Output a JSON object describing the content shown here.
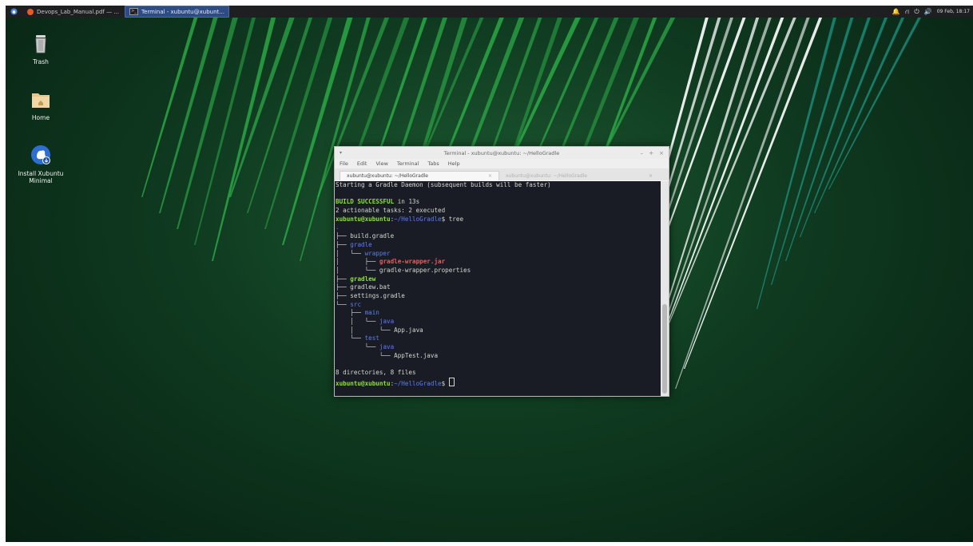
{
  "panel": {
    "tasks": [
      {
        "label": "Devops_Lab_Manual.pdf — ...",
        "active": false
      },
      {
        "label": "Terminal - xubuntu@xubunt...",
        "active": true
      }
    ],
    "clock": "09 Feb, 18:17"
  },
  "desktop": {
    "icons": [
      {
        "label": "Trash"
      },
      {
        "label": "Home"
      },
      {
        "label": "Install Xubuntu\nMinimal"
      }
    ]
  },
  "terminal": {
    "title": "Terminal - xubuntu@xubuntu: ~/HelloGradle",
    "menu": [
      "File",
      "Edit",
      "View",
      "Terminal",
      "Tabs",
      "Help"
    ],
    "tabs": [
      {
        "label": "xubuntu@xubuntu: ~/HelloGradle",
        "active": true
      },
      {
        "label": "xubuntu@xubuntu: ~/HelloGradle",
        "active": false
      }
    ],
    "lines": [
      [
        {
          "t": "Starting a Gradle Daemon (subsequent builds will be faster)",
          "c": "w"
        }
      ],
      [],
      [
        {
          "t": "BUILD SUCCESSFUL",
          "c": "g"
        },
        {
          "t": " in 13s",
          "c": "w"
        }
      ],
      [
        {
          "t": "2 actionable tasks: 2 executed",
          "c": "w"
        }
      ],
      [
        {
          "t": "xubuntu@xubuntu",
          "c": "g"
        },
        {
          "t": ":",
          "c": "w"
        },
        {
          "t": "~/HelloGradle",
          "c": "b"
        },
        {
          "t": "$ tree",
          "c": "w"
        }
      ],
      [
        {
          "t": ".",
          "c": "b"
        }
      ],
      [
        {
          "t": "├── build.gradle",
          "c": "w"
        }
      ],
      [
        {
          "t": "├── ",
          "c": "w"
        },
        {
          "t": "gradle",
          "c": "b"
        }
      ],
      [
        {
          "t": "│   └── ",
          "c": "w"
        },
        {
          "t": "wrapper",
          "c": "b"
        }
      ],
      [
        {
          "t": "│       ├── ",
          "c": "w"
        },
        {
          "t": "gradle-wrapper.jar",
          "c": "r"
        }
      ],
      [
        {
          "t": "│       └── gradle-wrapper.properties",
          "c": "w"
        }
      ],
      [
        {
          "t": "├── ",
          "c": "w"
        },
        {
          "t": "gradlew",
          "c": "g"
        }
      ],
      [
        {
          "t": "├── gradlew.bat",
          "c": "w"
        }
      ],
      [
        {
          "t": "├── settings.gradle",
          "c": "w"
        }
      ],
      [
        {
          "t": "└── ",
          "c": "w"
        },
        {
          "t": "src",
          "c": "b"
        }
      ],
      [
        {
          "t": "    ├── ",
          "c": "w"
        },
        {
          "t": "main",
          "c": "b"
        }
      ],
      [
        {
          "t": "    │   └── ",
          "c": "w"
        },
        {
          "t": "java",
          "c": "b"
        }
      ],
      [
        {
          "t": "    │       └── App.java",
          "c": "w"
        }
      ],
      [
        {
          "t": "    └── ",
          "c": "w"
        },
        {
          "t": "test",
          "c": "b"
        }
      ],
      [
        {
          "t": "        └── ",
          "c": "w"
        },
        {
          "t": "java",
          "c": "b"
        }
      ],
      [
        {
          "t": "            └── AppTest.java",
          "c": "w"
        }
      ],
      [],
      [
        {
          "t": "8 directories, 8 files",
          "c": "w"
        }
      ],
      [
        {
          "t": "xubuntu@xubuntu",
          "c": "g"
        },
        {
          "t": ":",
          "c": "w"
        },
        {
          "t": "~/HelloGradle",
          "c": "b"
        },
        {
          "t": "$ ",
          "c": "w"
        },
        {
          "t": "",
          "c": "cursor"
        }
      ]
    ]
  }
}
